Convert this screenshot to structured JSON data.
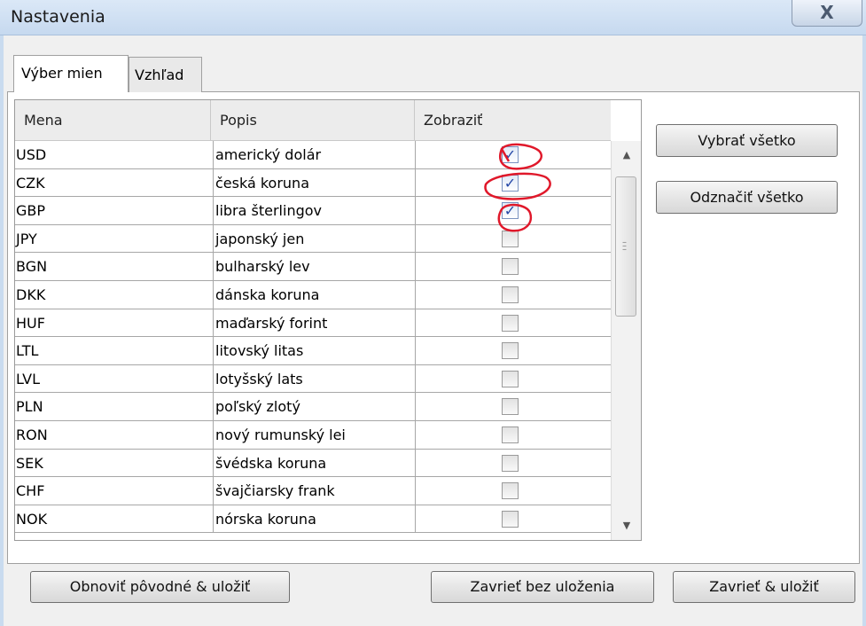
{
  "window": {
    "title": "Nastavenia",
    "close_label": "X"
  },
  "tabs": [
    {
      "label": "Výber mien"
    },
    {
      "label": "Vzhľad"
    }
  ],
  "grid": {
    "headers": {
      "mena": "Mena",
      "popis": "Popis",
      "zobrazit": "Zobraziť"
    },
    "rows": [
      {
        "mena": "USD",
        "popis": "americký dolár",
        "checked": true
      },
      {
        "mena": "CZK",
        "popis": "česká koruna",
        "checked": true
      },
      {
        "mena": "GBP",
        "popis": "libra šterlingov",
        "checked": true
      },
      {
        "mena": "JPY",
        "popis": "japonský jen",
        "checked": false
      },
      {
        "mena": "BGN",
        "popis": "bulharský lev",
        "checked": false
      },
      {
        "mena": "DKK",
        "popis": "dánska koruna",
        "checked": false
      },
      {
        "mena": "HUF",
        "popis": "maďarský forint",
        "checked": false
      },
      {
        "mena": "LTL",
        "popis": "litovský litas",
        "checked": false
      },
      {
        "mena": "LVL",
        "popis": "lotyšský lats",
        "checked": false
      },
      {
        "mena": "PLN",
        "popis": "poľský zlotý",
        "checked": false
      },
      {
        "mena": "RON",
        "popis": "nový rumunský lei",
        "checked": false
      },
      {
        "mena": "SEK",
        "popis": "švédska koruna",
        "checked": false
      },
      {
        "mena": "CHF",
        "popis": "švajčiarsky frank",
        "checked": false
      },
      {
        "mena": "NOK",
        "popis": "nórska koruna",
        "checked": false
      }
    ]
  },
  "buttons": {
    "select_all": "Vybrať všetko",
    "deselect_all": "Odznačiť všetko",
    "restore_save": "Obnoviť pôvodné & uložiť",
    "close_no_save": "Zavrieť bez uloženia",
    "close_save": "Zavrieť & uložiť"
  },
  "colors": {
    "annotation": "#e0182a",
    "checkmark": "#2447a6"
  }
}
